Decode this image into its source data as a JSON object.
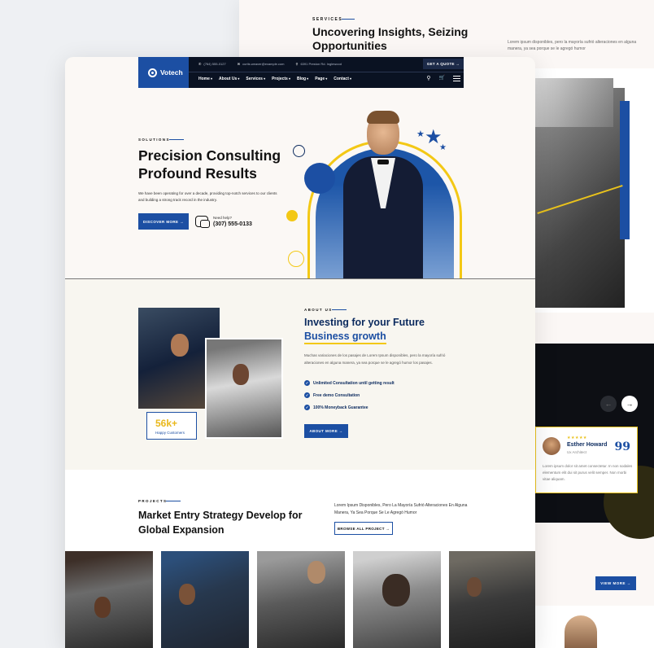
{
  "bg_page": {
    "services_label": "SERVICES",
    "heading": "Uncovering Insights, Seizing Opportunities",
    "description": "Lorem ipsum disponibles, pero la mayoría sufrió alteraciones en alguna manera, ya sea porque se le agregó humor",
    "slider_prev": "←",
    "slider_next": "→",
    "testimonial": {
      "stars": "★★★★★",
      "name": "Esther Howard",
      "role": "Ux Architect",
      "quote_mark": "99",
      "text": "Lorem ipsum dolor sit amet consectetur. In non sodales elementum elit dui sit purus velit semper. Non morbi vitae aliquam."
    },
    "view_more": "VIEW MORE →"
  },
  "header": {
    "logo_text": "Votech",
    "contacts": [
      {
        "icon": "phone-icon",
        "glyph": "✆",
        "text": "(764) 555-0127"
      },
      {
        "icon": "mail-icon",
        "glyph": "✉",
        "text": "curtis.weaver@example.com"
      },
      {
        "icon": "location-icon",
        "glyph": "⚲",
        "text": "6391 Preston Rd. Inglewood"
      }
    ],
    "get_quote": "GET A QUOTE →",
    "menu": [
      "Home",
      "About Us",
      "Services",
      "Projects",
      "Blog",
      "Page",
      "Contact"
    ],
    "search_glyph": "⚲",
    "cart_glyph": "🛒"
  },
  "hero": {
    "label": "SOLUTIONS",
    "title": "Precision Consulting Profound Results",
    "description": "We have been operating for over a decade, providing top-notch services to our clients and building a strong track record in the industry.",
    "cta": "DISCOVER MORE →",
    "help_label": "Need help?",
    "help_phone": "(307) 555-0133"
  },
  "about": {
    "label": "ABOUT US",
    "title_line1": "Investing for your Future",
    "title_line2": "Business growth",
    "description": "Muchas variaciones de los pasajes de Lorem Ipsum disponibles, pero la mayoría sufrió alteraciones en alguna manera, ya sea porque se le agregó humor los pasajes.",
    "checks": [
      "Unlimited Consultation until getting result",
      "Free demo Consultation",
      "100% Moneyback Guarantee"
    ],
    "stat_number": "56k+",
    "stat_label": "Happy Customers",
    "cta": "ABOUT MORE →"
  },
  "projects": {
    "label": "PROJECTS",
    "title": "Market Entry Strategy Develop for Global Expansion",
    "description": "Lorem Ipsum Disponibles, Pero La Mayoría Sufrió Alteraciones En Alguna Manera, Ya Sea Porque Se Le Agregó Humor",
    "cta": "BROWSE ALL PROJECT →"
  }
}
